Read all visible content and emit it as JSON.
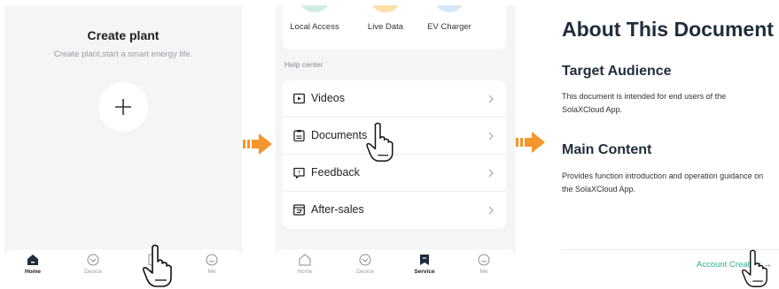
{
  "panel1": {
    "title": "Create plant",
    "subtitle": "Create plant,start a smart energy life.",
    "add_icon": "plus-icon",
    "tabs": [
      {
        "label": "Home",
        "icon": "home-icon",
        "active": true
      },
      {
        "label": "Device",
        "icon": "device-icon",
        "active": false
      },
      {
        "label": "Service",
        "icon": "service-icon",
        "active": false
      },
      {
        "label": "Me",
        "icon": "me-icon",
        "active": false
      }
    ]
  },
  "panel2": {
    "quick_actions": [
      {
        "label": "Local Access",
        "color": "#cfeee3"
      },
      {
        "label": "Live Data",
        "color": "#fbe0a8"
      },
      {
        "label": "EV Charger",
        "color": "#d6e8f7"
      }
    ],
    "help_center_title": "Help center",
    "help_items": [
      {
        "label": "Videos",
        "icon": "video-icon"
      },
      {
        "label": "Documents",
        "icon": "document-icon"
      },
      {
        "label": "Feedback",
        "icon": "feedback-icon"
      },
      {
        "label": "After-sales",
        "icon": "after-sales-icon"
      }
    ],
    "tabs": [
      {
        "label": "Home",
        "icon": "home-icon",
        "active": false
      },
      {
        "label": "Device",
        "icon": "device-icon",
        "active": false
      },
      {
        "label": "Service",
        "icon": "service-icon",
        "active": true
      },
      {
        "label": "Me",
        "icon": "me-icon",
        "active": false
      }
    ]
  },
  "panel3": {
    "title": "About This Document",
    "sections": [
      {
        "heading": "Target Audience",
        "text": "This document is intended for end users of the SolaXCloud App."
      },
      {
        "heading": "Main Content",
        "text": "Provides function introduction and operation guidance on the SolaXCloud App."
      }
    ],
    "next_link": "Account Creation",
    "next_arrow": "→"
  },
  "colors": {
    "step_arrow": "#f5962a",
    "link": "#2bb38d",
    "panel_bg": "#f4f5f7"
  }
}
